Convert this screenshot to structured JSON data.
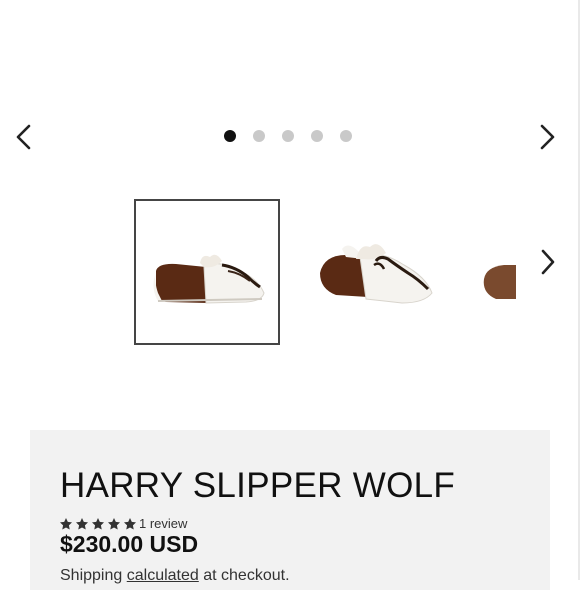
{
  "gallery": {
    "prev_icon": "chevron-left-icon",
    "next_icon": "chevron-right-icon",
    "dots_count": 5,
    "active_dot": 1
  },
  "thumbnails": {
    "next_icon": "chevron-right-icon",
    "items": [
      {
        "alt": "slipper-side-view",
        "active": true
      },
      {
        "alt": "slipper-angle-view",
        "active": false
      },
      {
        "alt": "slipper-partial-view",
        "active": false
      }
    ]
  },
  "product": {
    "title": "HARRY SLIPPER WOLF",
    "rating": 5,
    "rating_max": 5,
    "review_count_text": "1 review",
    "price": "$230.00 USD",
    "shipping_prefix": "Shipping",
    "shipping_link": "calculated",
    "shipping_suffix": "at checkout."
  },
  "colors": {
    "panel_bg": "#f2f2f2",
    "active_dot": "#111111",
    "inactive_dot": "#c9c9c9",
    "thumb_border": "#454545",
    "fur_brown": "#5a2a14",
    "fur_white": "#f5f3ef"
  }
}
